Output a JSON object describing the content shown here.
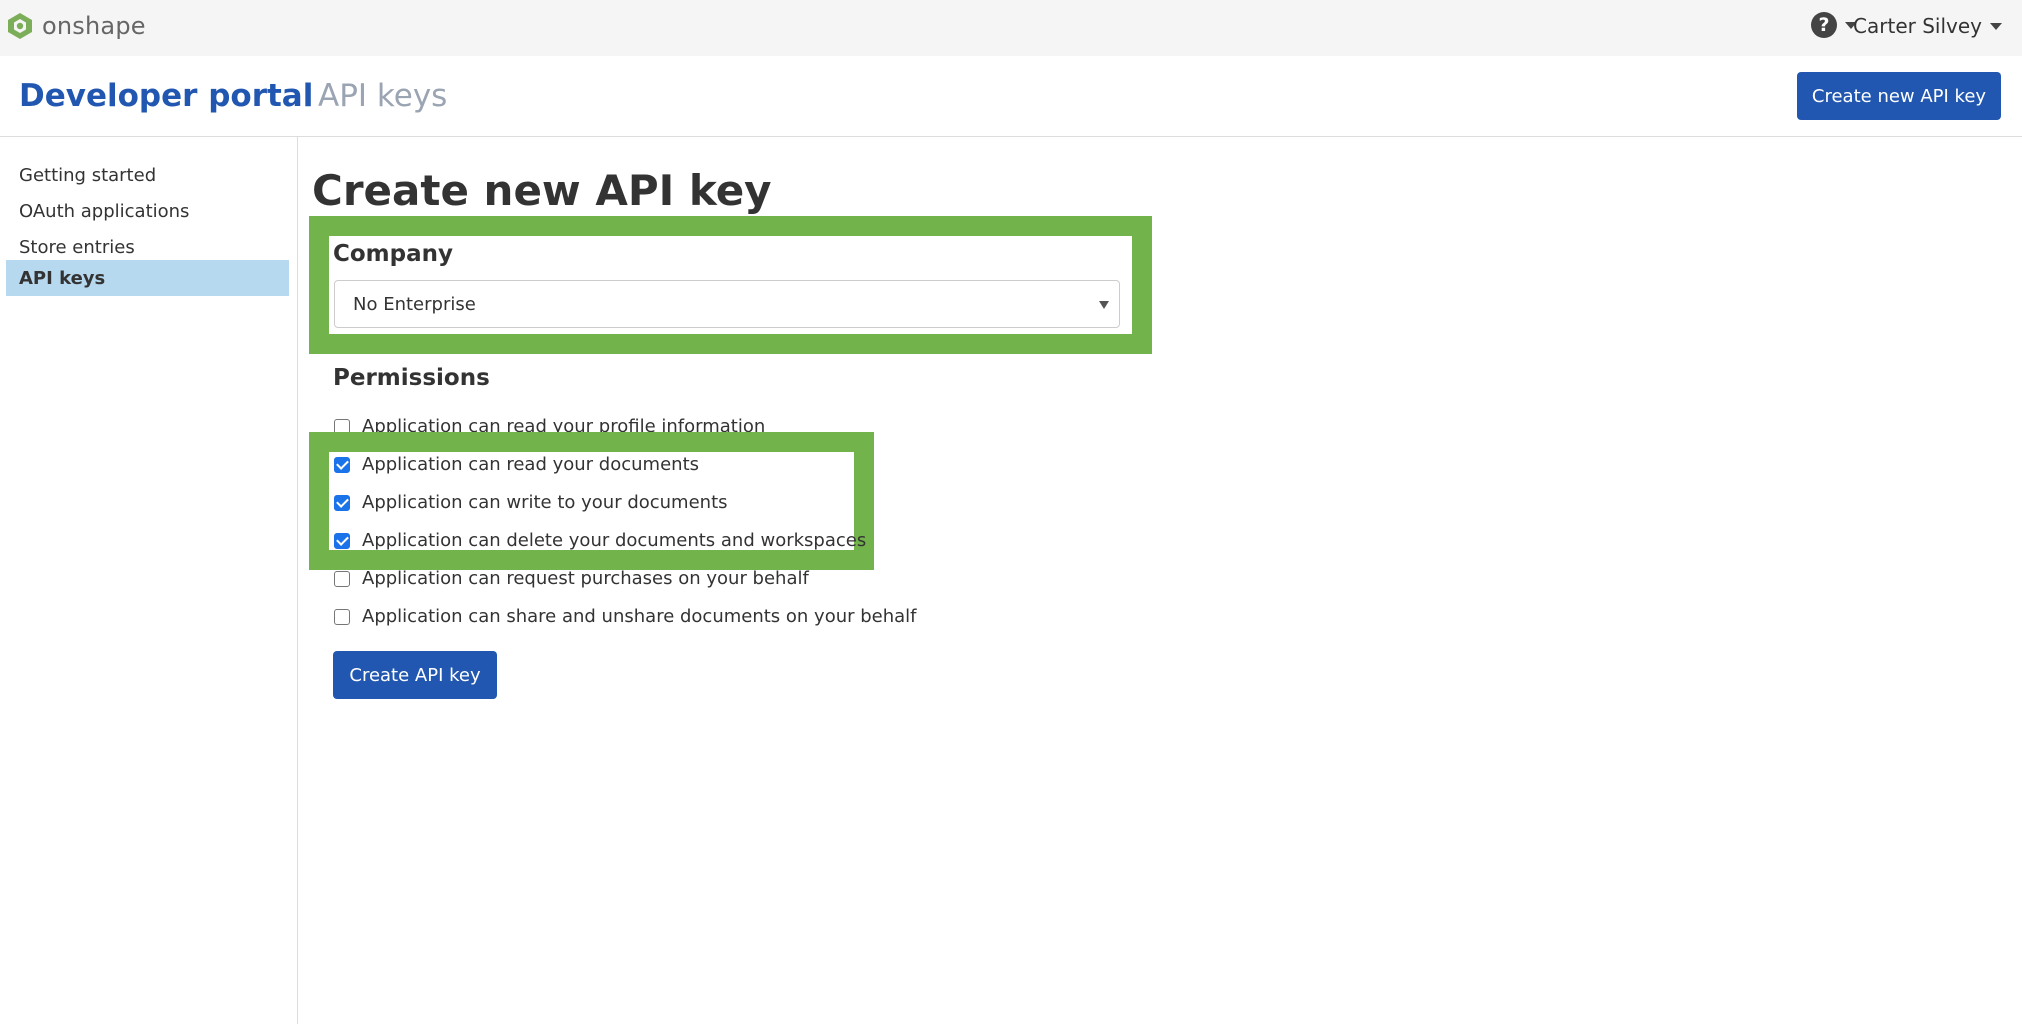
{
  "brand": {
    "name": "onshape"
  },
  "topbar": {
    "help_icon": "question-circle-icon",
    "user_name": "Carter Silvey"
  },
  "header": {
    "title": "Developer portal",
    "crumb": "API keys",
    "new_key_button": "Create new API key"
  },
  "sidebar": {
    "items": [
      {
        "label": "Getting started",
        "active": false
      },
      {
        "label": "OAuth applications",
        "active": false
      },
      {
        "label": "Store entries",
        "active": false
      },
      {
        "label": "API keys",
        "active": true
      }
    ]
  },
  "main": {
    "title": "Create new API key",
    "company": {
      "label": "Company",
      "selected": "No Enterprise"
    },
    "permissions": {
      "label": "Permissions",
      "items": [
        {
          "label": "Application can read your profile information",
          "checked": false
        },
        {
          "label": "Application can read your documents",
          "checked": true
        },
        {
          "label": "Application can write to your documents",
          "checked": true
        },
        {
          "label": "Application can delete your documents and workspaces",
          "checked": true
        },
        {
          "label": "Application can request purchases on your behalf",
          "checked": false
        },
        {
          "label": "Application can share and unshare documents on your behalf",
          "checked": false
        }
      ]
    },
    "create_button": "Create API key"
  },
  "colors": {
    "brand_blue": "#2157b0",
    "highlight_green": "#72b34b",
    "active_nav": "#b6d9ef",
    "checkbox_blue": "#1a73e8"
  }
}
